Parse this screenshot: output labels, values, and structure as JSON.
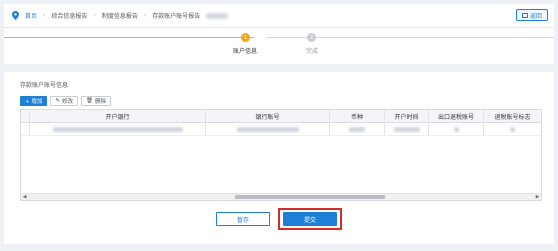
{
  "breadcrumb": {
    "home": "首页",
    "items": [
      "综合信息报告",
      "制度信息报告",
      "存款账户账号报告"
    ]
  },
  "header": {
    "back_label": "返回"
  },
  "steps": [
    {
      "num": "1",
      "label": "账户信息",
      "state": "active"
    },
    {
      "num": "2",
      "label": "完成",
      "state": "pending"
    }
  ],
  "section": {
    "title": "存款账户账号信息"
  },
  "toolbar": {
    "add": "+ 增加",
    "edit": "修改",
    "delete": "删除"
  },
  "table": {
    "headers": [
      "开户银行",
      "银行账号",
      "币种",
      "开户时间",
      "出口退税账号",
      "退税账号标志"
    ]
  },
  "actions": {
    "save": "暂存",
    "submit": "提交"
  },
  "colors": {
    "accent": "#1e7fd6",
    "step_active": "#f2a81d",
    "highlight": "#d42b2b"
  }
}
